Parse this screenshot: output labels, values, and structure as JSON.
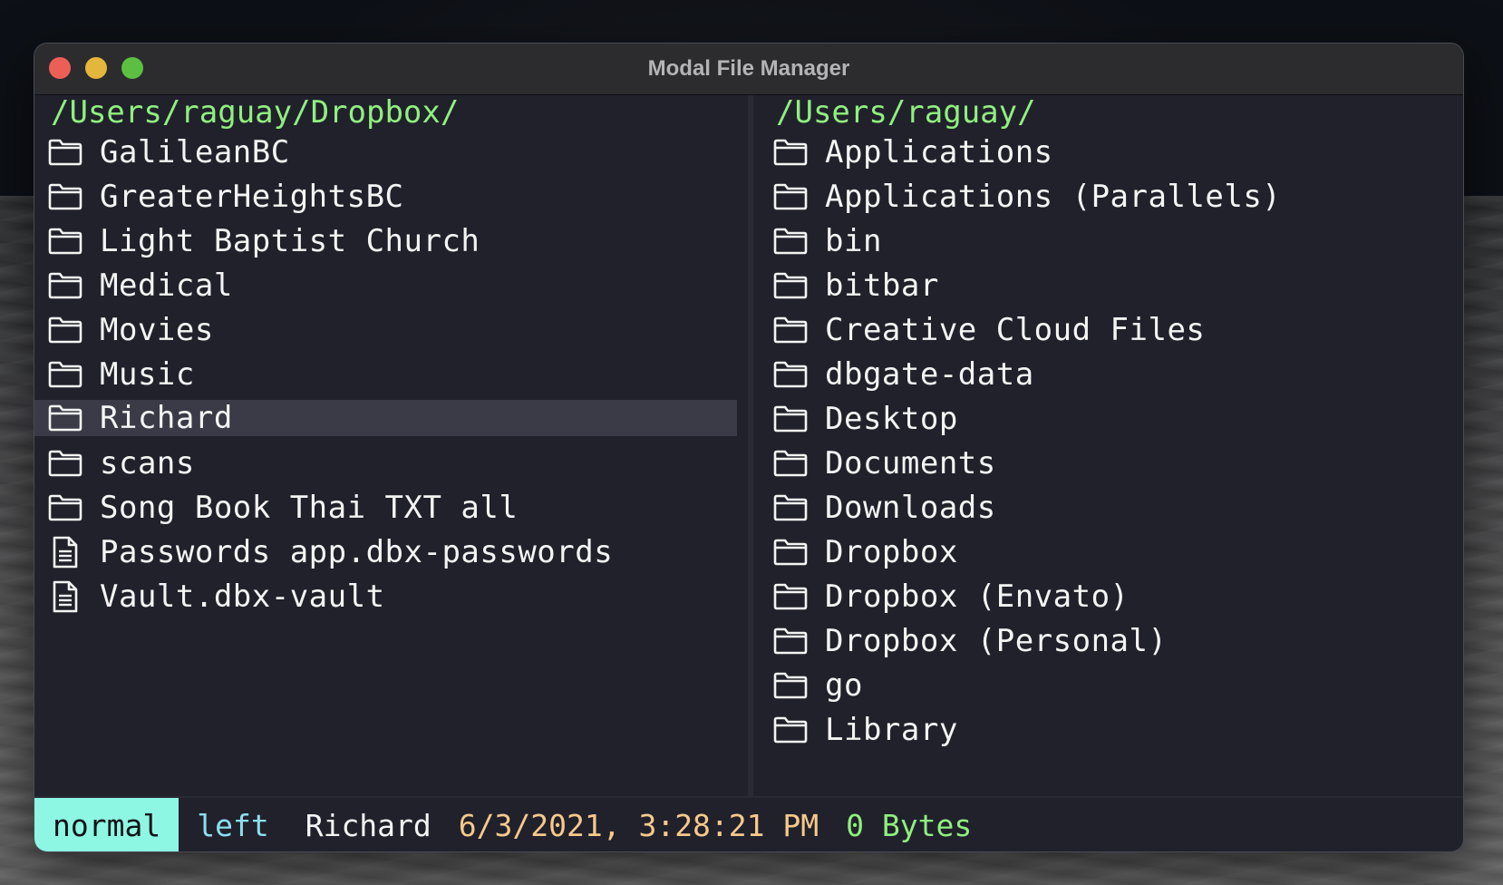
{
  "window": {
    "title": "Modal File Manager"
  },
  "left_pane": {
    "path": "/Users/raguay/Dropbox/",
    "entries": [
      {
        "name": "GalileanBC",
        "type": "folder"
      },
      {
        "name": "GreaterHeightsBC",
        "type": "folder"
      },
      {
        "name": "Light Baptist Church",
        "type": "folder"
      },
      {
        "name": "Medical",
        "type": "folder"
      },
      {
        "name": "Movies",
        "type": "folder"
      },
      {
        "name": "Music",
        "type": "folder"
      },
      {
        "name": "Richard",
        "type": "folder",
        "selected": true
      },
      {
        "name": "scans",
        "type": "folder"
      },
      {
        "name": "Song Book Thai TXT all",
        "type": "folder"
      },
      {
        "name": "Passwords app.dbx-passwords",
        "type": "file"
      },
      {
        "name": "Vault.dbx-vault",
        "type": "file"
      }
    ]
  },
  "right_pane": {
    "path": "/Users/raguay/",
    "entries": [
      {
        "name": "Applications",
        "type": "folder"
      },
      {
        "name": "Applications (Parallels)",
        "type": "folder"
      },
      {
        "name": "bin",
        "type": "folder"
      },
      {
        "name": "bitbar",
        "type": "folder"
      },
      {
        "name": "Creative Cloud Files",
        "type": "folder"
      },
      {
        "name": "dbgate-data",
        "type": "folder"
      },
      {
        "name": "Desktop",
        "type": "folder"
      },
      {
        "name": "Documents",
        "type": "folder"
      },
      {
        "name": "Downloads",
        "type": "folder"
      },
      {
        "name": "Dropbox",
        "type": "folder"
      },
      {
        "name": "Dropbox (Envato)",
        "type": "folder"
      },
      {
        "name": "Dropbox (Personal)",
        "type": "folder"
      },
      {
        "name": "go",
        "type": "folder"
      },
      {
        "name": "Library",
        "type": "folder"
      }
    ]
  },
  "status": {
    "mode": "normal",
    "side": "left",
    "selected": "Richard",
    "date": "6/3/2021, 3:28:21 PM",
    "size": "0 Bytes"
  },
  "colors": {
    "path": "#8ff07e",
    "mode_bg": "#8df7e4",
    "side": "#8be0ee",
    "date": "#f7c98a",
    "size": "#8ff07e",
    "selection_bg": "#3b3b48"
  }
}
